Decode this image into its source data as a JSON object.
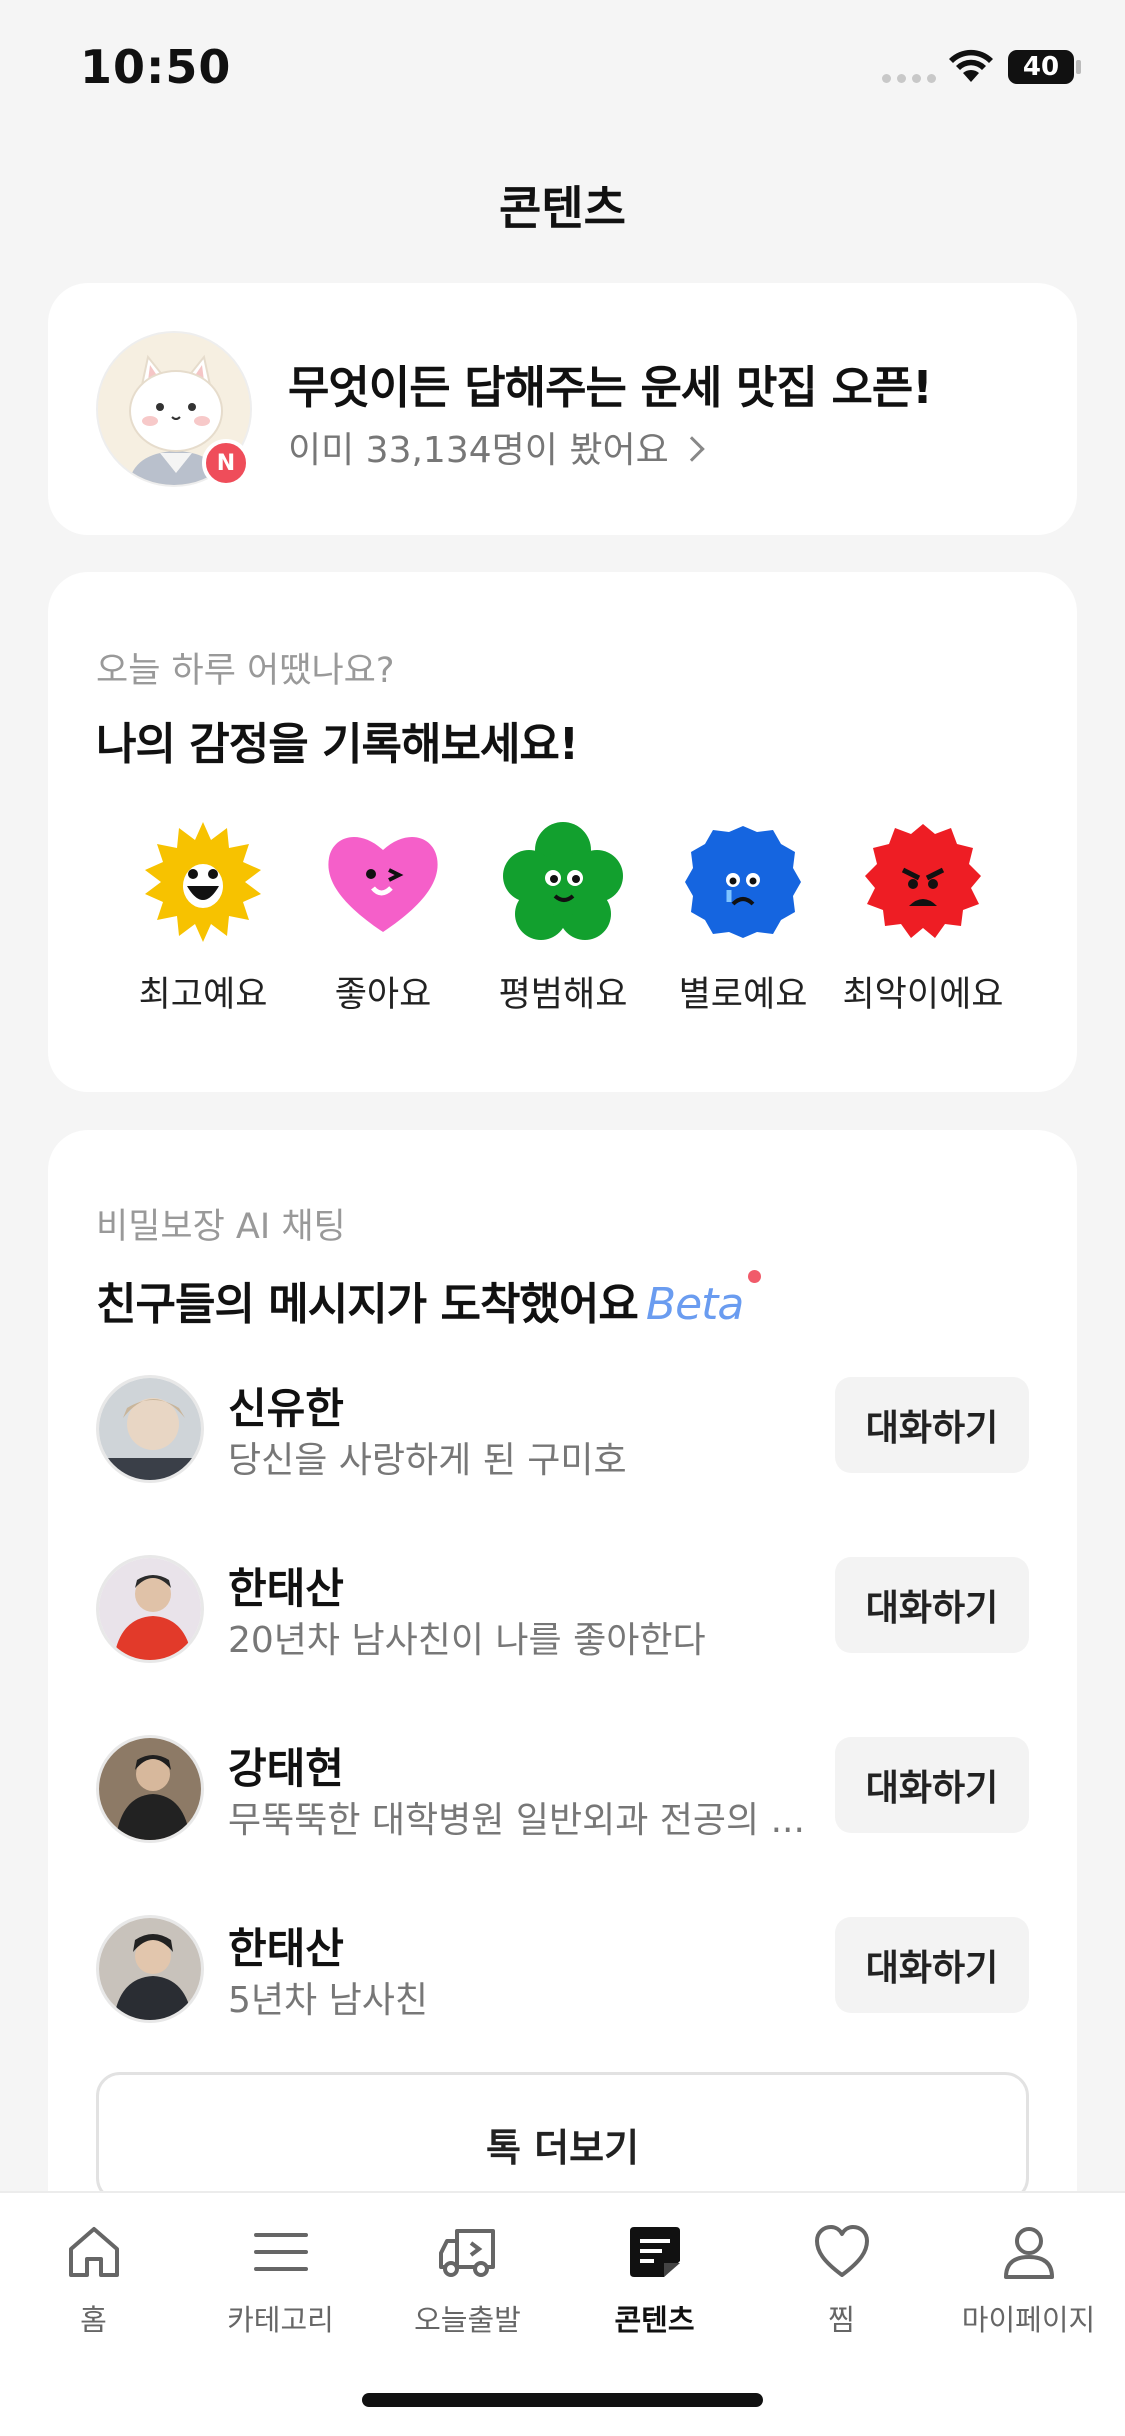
{
  "status_bar": {
    "time": "10:50",
    "battery": "40"
  },
  "page_title": "콘텐츠",
  "banner": {
    "title": "무엇이든 답해주는 운세 맛집 오픈!",
    "subtitle": "이미 33,134명이 봤어요",
    "badge": "N"
  },
  "emotion": {
    "subtitle": "오늘 하루 어땠나요?",
    "title": "나의 감정을 기록해보세요!",
    "items": [
      {
        "label": "최고예요",
        "color": "#f7c200",
        "icon": "sun-face-icon"
      },
      {
        "label": "좋아요",
        "color": "#f55fc9",
        "icon": "heart-face-icon"
      },
      {
        "label": "평범해요",
        "color": "#12a02e",
        "icon": "flower-face-icon"
      },
      {
        "label": "별로예요",
        "color": "#1565e0",
        "icon": "sad-blob-icon"
      },
      {
        "label": "최악이에요",
        "color": "#ee1d24",
        "icon": "angry-blob-icon"
      }
    ]
  },
  "chat": {
    "subtitle": "비밀보장 AI 채팅",
    "title": "친구들의 메시지가 도착했어요",
    "beta": "Beta",
    "button_label": "대화하기",
    "friends": [
      {
        "name": "신유한",
        "desc": "당신을 사랑하게 된 구미호"
      },
      {
        "name": "한태산",
        "desc": "20년차 남사친이 나를 좋아한다"
      },
      {
        "name": "강태현",
        "desc": "무뚝뚝한 대학병원 일반외과 전공의 ..."
      },
      {
        "name": "한태산",
        "desc": "5년차 남사친"
      }
    ],
    "more_label": "톡 더보기"
  },
  "tabbar": {
    "items": [
      {
        "label": "홈",
        "icon": "home-icon"
      },
      {
        "label": "카테고리",
        "icon": "menu-icon"
      },
      {
        "label": "오늘출발",
        "icon": "truck-icon"
      },
      {
        "label": "콘텐츠",
        "icon": "content-icon",
        "active": true
      },
      {
        "label": "찜",
        "icon": "heart-icon"
      },
      {
        "label": "마이페이지",
        "icon": "person-icon"
      }
    ]
  },
  "colors": {
    "accent_beta": "#6a9cf0",
    "badge_red": "#ef4d5a",
    "background": "#f5f5f5"
  }
}
